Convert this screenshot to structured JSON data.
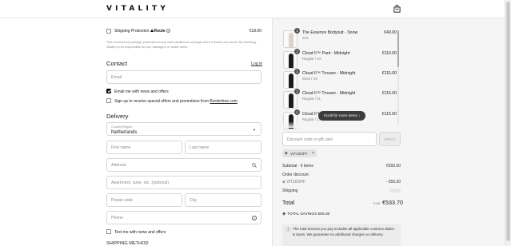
{
  "header": {
    "logo": "VITALITY",
    "bag_icon": "shopping-bag-icon"
  },
  "shipping_protection": {
    "label_prefix": "Shipping Protection",
    "brand": "Route",
    "price": "€18.00",
    "checked": false
  },
  "protection_note": "*We recommend package protection so you have additional coverage since it leaves our hands. By declining, Vitality is not responsible for lost, damaged, or stolen items.",
  "contact": {
    "title": "Contact",
    "login_label": "Log in",
    "email_placeholder": "Email",
    "news_label": "Email me with news and offers",
    "news_checked": true,
    "borderfree_prefix": "Sign up to receive special offers and promotions from ",
    "borderfree_link": "Borderfree.com",
    "borderfree_checked": false
  },
  "delivery": {
    "title": "Delivery",
    "country_label": "Country/Region",
    "country_value": "Netherlands",
    "first_name_placeholder": "First name",
    "last_name_placeholder": "Last name",
    "address_placeholder": "Address",
    "apartment_placeholder": "Apartment, suite, etc. (optional)",
    "postal_placeholder": "Postal code",
    "city_placeholder": "City",
    "phone_placeholder": "Phone",
    "text_news_label": "Text me with news and offers",
    "shipping_method_title": "SHIPPING METHOD"
  },
  "cart": {
    "items": [
      {
        "qty": "1",
        "name": "The Essence Bodysuit - Snow",
        "variant": "XXL",
        "price": "€40.00",
        "tone": "light"
      },
      {
        "qty": "1",
        "name": "Cloud II™ Pant - Midnight",
        "variant": "Regular / XS",
        "price": "€110.00",
        "tone": "dark"
      },
      {
        "qty": "1",
        "name": "Cloud II™ Trouser - Midnight",
        "variant": "Short / XS",
        "price": "€115.00",
        "tone": "dark"
      },
      {
        "qty": "1",
        "name": "Cloud II™ Trouser - Midnight",
        "variant": "Regular / XL",
        "price": "€115.00",
        "tone": "dark"
      },
      {
        "qty": "1",
        "name": "Cloud II™ Trouser - Midnight",
        "variant": "Regular / 2XS",
        "price": "€115.00",
        "tone": "dark"
      }
    ],
    "scroll_pill": "Scroll for more items"
  },
  "discount": {
    "placeholder": "Discount code or gift card",
    "apply_label": "APPLY",
    "applied_code": "VIT10OFF"
  },
  "summary": {
    "subtotal_label": "Subtotal · 6 items",
    "subtotal_value": "€593.00",
    "order_discount_label": "Order discount",
    "discount_code": "VIT10OFF",
    "discount_value": "- €59.30",
    "shipping_label": "Shipping",
    "shipping_value": "",
    "total_label": "Total",
    "currency": "EUR",
    "total_value": "€533.70",
    "savings_label": "TOTAL SAVINGS",
    "savings_value": "€59.30",
    "info_text": "The total amount you pay includes all applicable customs duties & taxes. We guarantee no additional charges on delivery."
  }
}
